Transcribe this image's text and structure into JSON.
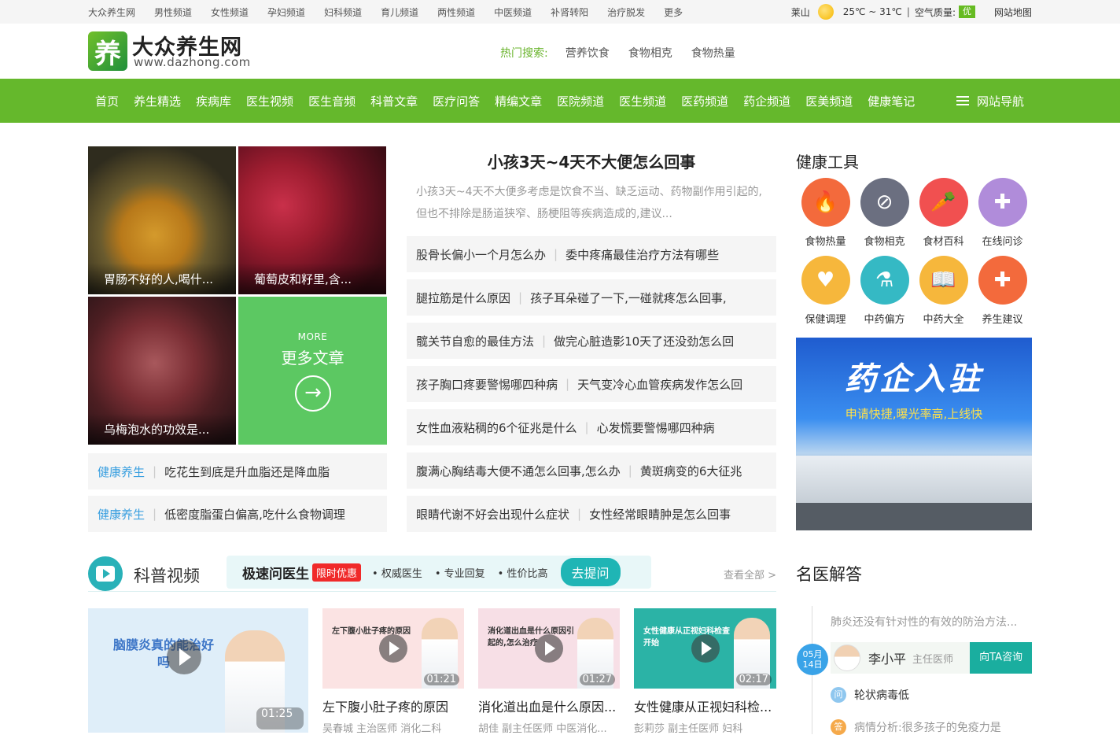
{
  "topbar": {
    "links": [
      "大众养生网",
      "男性频道",
      "女性频道",
      "孕妇频道",
      "妇科频道",
      "育儿频道",
      "两性频道",
      "中医频道",
      "补肾转阳",
      "治疗脱发",
      "更多"
    ],
    "city": "莱山",
    "temp": "25℃ ~ 31℃",
    "sep": "|",
    "air_label": "空气质量:",
    "air_value": "优",
    "sitemap": "网站地图"
  },
  "logo": {
    "mark": "养",
    "title": "大众养生网",
    "url": "www.dazhong.com"
  },
  "hot_search": {
    "label": "热门搜索:",
    "keywords": [
      "营养饮食",
      "食物相克",
      "食物热量"
    ]
  },
  "main_nav": {
    "items": [
      "首页",
      "养生精选",
      "疾病库",
      "医生视频",
      "医生音频",
      "科普文章",
      "医疗问答",
      "精编文章",
      "医院频道",
      "医生频道",
      "医药频道",
      "药企频道",
      "医美频道",
      "健康笔记"
    ],
    "site_nav": "网站导航"
  },
  "featured": {
    "tiles": [
      {
        "caption": "胃肠不好的人,喝什..."
      },
      {
        "caption": "葡萄皮和籽里,含..."
      },
      {
        "caption": "乌梅泡水的功效是..."
      }
    ],
    "more_en": "MORE",
    "more_cn": "更多文章",
    "more_icon": "→",
    "health_rows": [
      {
        "tag": "健康养生",
        "sep": "|",
        "title": "吃花生到底是升血脂还是降血脂"
      },
      {
        "tag": "健康养生",
        "sep": "|",
        "title": "低密度脂蛋白偏高,吃什么食物调理"
      }
    ]
  },
  "headline": {
    "title": "小孩3天~4天不大便怎么回事",
    "summary": "小孩3天~4天不大便多考虑是饮食不当、缺乏运动、药物副作用引起的,但也不排除是肠道狭窄、肠梗阻等疾病造成的,建议..."
  },
  "news_rows": [
    {
      "a": "股骨长偏小一个月怎么办",
      "sep": "|",
      "b": "委中疼痛最佳治疗方法有哪些"
    },
    {
      "a": "腿拉筋是什么原因",
      "sep": "|",
      "b": "孩子耳朵碰了一下,一碰就疼怎么回事,"
    },
    {
      "a": "髋关节自愈的最佳方法",
      "sep": "|",
      "b": "做完心脏造影10天了还没劲怎么回"
    },
    {
      "a": "孩子胸口疼要警惕哪四种病",
      "sep": "|",
      "b": "天气变冷心血管疾病发作怎么回"
    },
    {
      "a": "女性血液粘稠的6个征兆是什么",
      "sep": "|",
      "b": "心发慌要警惕哪四种病"
    },
    {
      "a": "腹满心胸结毒大便不通怎么回事,怎么办",
      "sep": "|",
      "b": "黄斑病变的6大征兆"
    },
    {
      "a": "眼睛代谢不好会出现什么症状",
      "sep": "|",
      "b": "女性经常眼睛肿是怎么回事"
    }
  ],
  "tools": {
    "title": "健康工具",
    "items": [
      {
        "label": "食物热量",
        "icon": "fire-icon",
        "glyph": "🔥",
        "color": "#f36a3c"
      },
      {
        "label": "食物相克",
        "icon": "prohibit-icon",
        "glyph": "⊘",
        "color": "#6b6f80"
      },
      {
        "label": "食材百科",
        "icon": "vegetable-icon",
        "glyph": "🥕",
        "color": "#f15050"
      },
      {
        "label": "在线问诊",
        "icon": "chat-icon",
        "glyph": "✚",
        "color": "#b08cda"
      },
      {
        "label": "保健调理",
        "icon": "heart-hand-icon",
        "glyph": "♥",
        "color": "#f6b73c"
      },
      {
        "label": "中药偏方",
        "icon": "mortar-icon",
        "glyph": "⚗",
        "color": "#35b9c4"
      },
      {
        "label": "中药大全",
        "icon": "book-icon",
        "glyph": "📖",
        "color": "#f6b73c"
      },
      {
        "label": "养生建议",
        "icon": "cross-icon",
        "glyph": "✚",
        "color": "#f36a3c"
      }
    ]
  },
  "ad": {
    "title": "药企入驻",
    "subtitle": "申请快捷,曝光率高,上线快"
  },
  "video_section": {
    "title": "科普视频",
    "ask_title": "极速问医生",
    "ask_badge": "限时优惠",
    "ask_features": [
      "权威医生",
      "专业回复",
      "性价比高"
    ],
    "ask_button": "去提问",
    "view_all": "查看全部 >",
    "big": {
      "thumb_text": "脑膜炎真的能治好吗",
      "duration": "01:25"
    },
    "cards": [
      {
        "thumb_text": "左下腹小肚子疼的原因",
        "duration": "01:21",
        "title": "左下腹小肚子疼的原因",
        "meta": "吴春城  主治医师  消化二科"
      },
      {
        "thumb_text": "消化道出血是什么原因引起的,怎么治疗",
        "duration": "01:27",
        "title": "消化道出血是什么原因...",
        "meta": "胡佳  副主任医师  中医消化..."
      },
      {
        "thumb_text": "女性健康从正视妇科检查开始",
        "duration": "02:17",
        "title": "女性健康从正视妇科检...",
        "meta": "彭莉莎  副主任医师  妇科"
      }
    ]
  },
  "experts": {
    "title": "名医解答",
    "question_prev": "肺炎还没有针对性的有效的防治方法...",
    "date": {
      "month": "05月",
      "day": "14日"
    },
    "doctor": {
      "name": "李小平",
      "rank": "主任医师",
      "button": "向TA咨询"
    },
    "q_mark": "问",
    "question": "轮状病毒低",
    "a_mark": "答",
    "answer": "病情分析:很多孩子的免疫力是"
  },
  "colors": {
    "brand_green": "#65b82c",
    "teal": "#1fb5b5",
    "link_blue": "#3ba0e0"
  }
}
